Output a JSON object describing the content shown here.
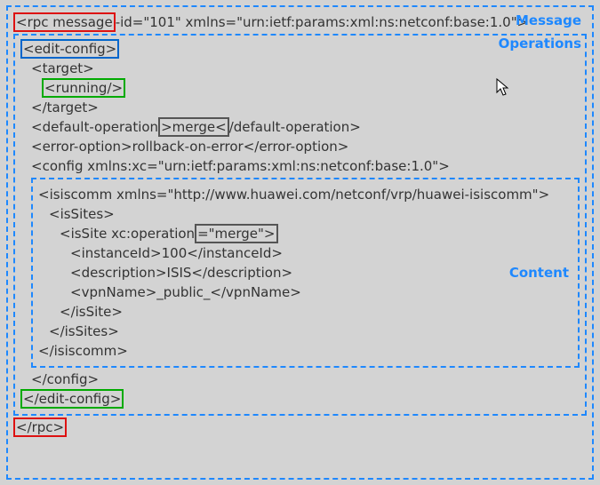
{
  "labels": {
    "message": "Message",
    "operations": "Operations",
    "content": "Content"
  },
  "rpc": {
    "open_tag": "<rpc message",
    "open_rest": "-id=\"101\" xmlns=\"urn:ietf:params:xml:ns:netconf:base:1.0\">",
    "close": "</rpc>"
  },
  "ops": {
    "edit_open": "<edit-config>",
    "target_open": "<target>",
    "running": "<running/>",
    "target_close": "</target>",
    "default_op_pre": "<default-operation",
    "default_op_val": ">merge<",
    "default_op_post": "/default-operation>",
    "error_option": "<error-option>rollback-on-error</error-option>",
    "config_open": "<config xmlns:xc=\"urn:ietf:params:xml:ns:netconf:base:1.0\">",
    "config_close": "</config>",
    "edit_close": "</edit-config>"
  },
  "content": {
    "isiscomm_open": "<isiscomm xmlns=\"http://www.huawei.com/netconf/vrp/huawei-isiscomm\">",
    "isSites_open": "<isSites>",
    "isSite_pre": "<isSite xc:operation",
    "isSite_val": "=\"merge\">",
    "instanceId": "<instanceId>100</instanceId>",
    "description": "<description>ISIS</description>",
    "vpnName": "<vpnName>_public_</vpnName>",
    "isSite_close": "</isSite>",
    "isSites_close": "</isSites>",
    "isiscomm_close": "</isiscomm>"
  }
}
